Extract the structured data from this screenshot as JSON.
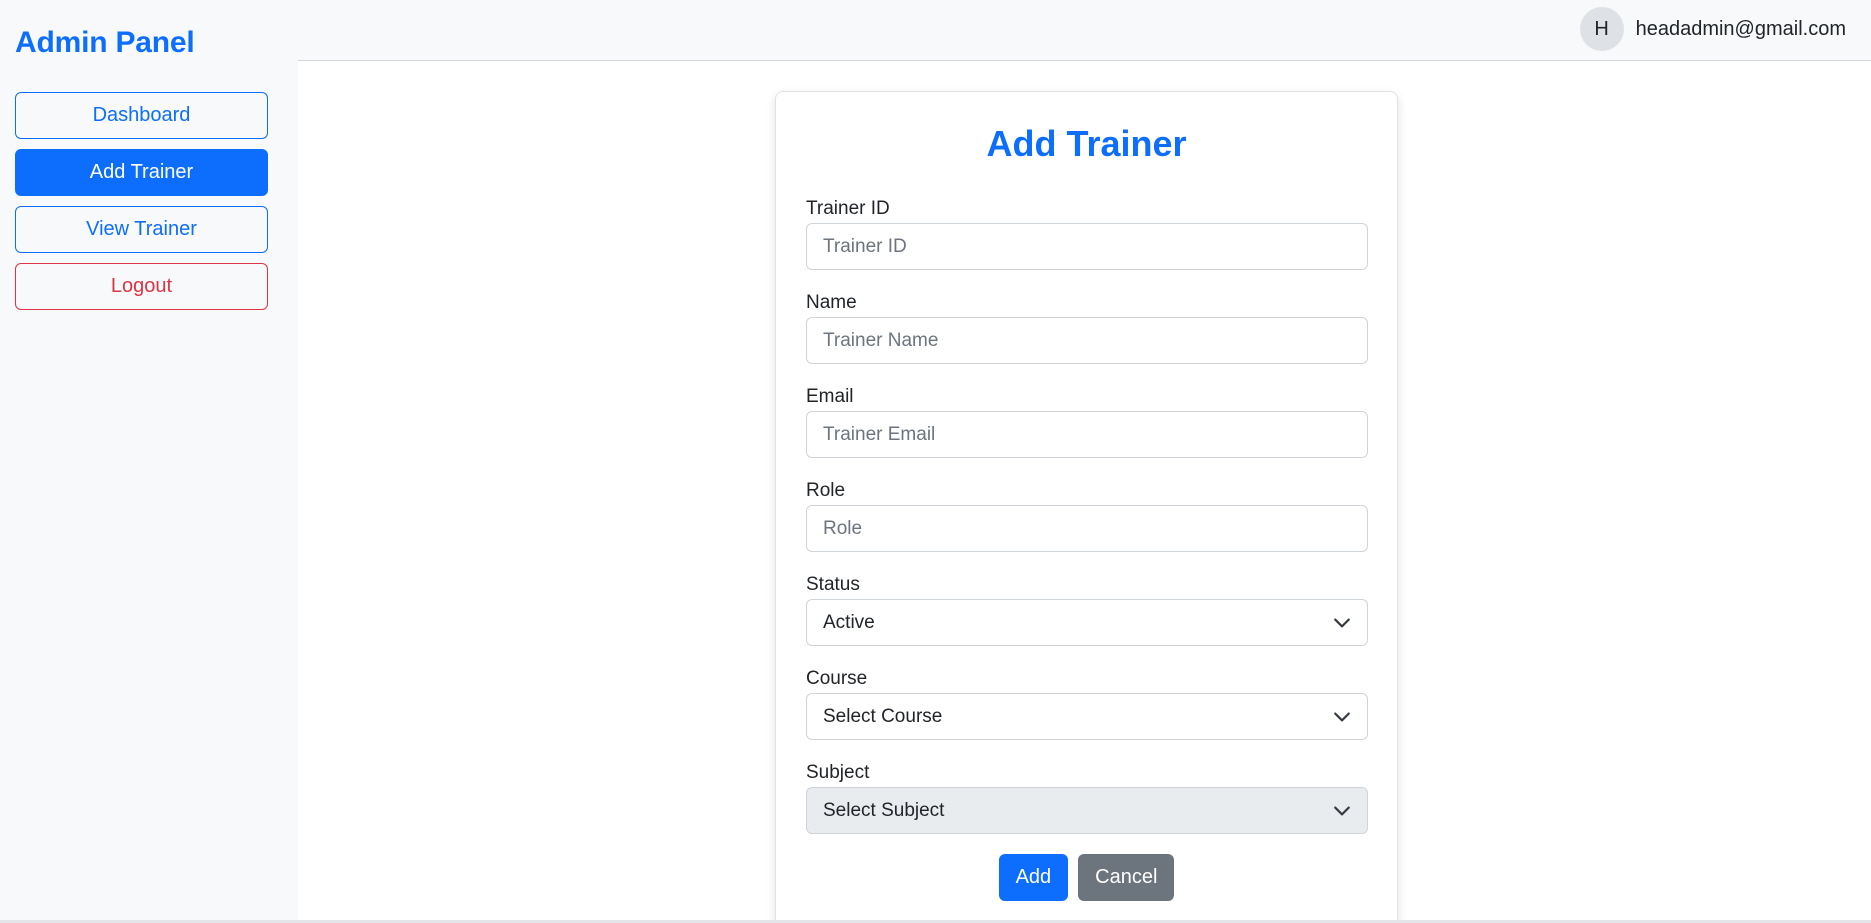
{
  "sidebar": {
    "brand": "Admin Panel",
    "items": [
      {
        "label": "Dashboard"
      },
      {
        "label": "Add Trainer"
      },
      {
        "label": "View Trainer"
      },
      {
        "label": "Logout"
      }
    ]
  },
  "header": {
    "avatar_initial": "H",
    "user_email": "headadmin@gmail.com"
  },
  "form": {
    "title": "Add Trainer",
    "fields": [
      {
        "label": "Trainer ID",
        "placeholder": "Trainer ID",
        "value": ""
      },
      {
        "label": "Name",
        "placeholder": "Trainer Name",
        "value": ""
      },
      {
        "label": "Email",
        "placeholder": "Trainer Email",
        "value": ""
      },
      {
        "label": "Role",
        "placeholder": "Role",
        "value": ""
      }
    ],
    "selects": [
      {
        "label": "Status",
        "selected": "Active"
      },
      {
        "label": "Course",
        "selected": "Select Course"
      },
      {
        "label": "Subject",
        "selected": "Select Subject"
      }
    ],
    "add_label": "Add",
    "cancel_label": "Cancel"
  },
  "colors": {
    "primary": "#0d6efd",
    "danger": "#dc3545",
    "secondary": "#6c757d",
    "sidebar_bg": "#f8f9fa"
  },
  "icons": {
    "select_arrow": "chevron-down-icon"
  }
}
